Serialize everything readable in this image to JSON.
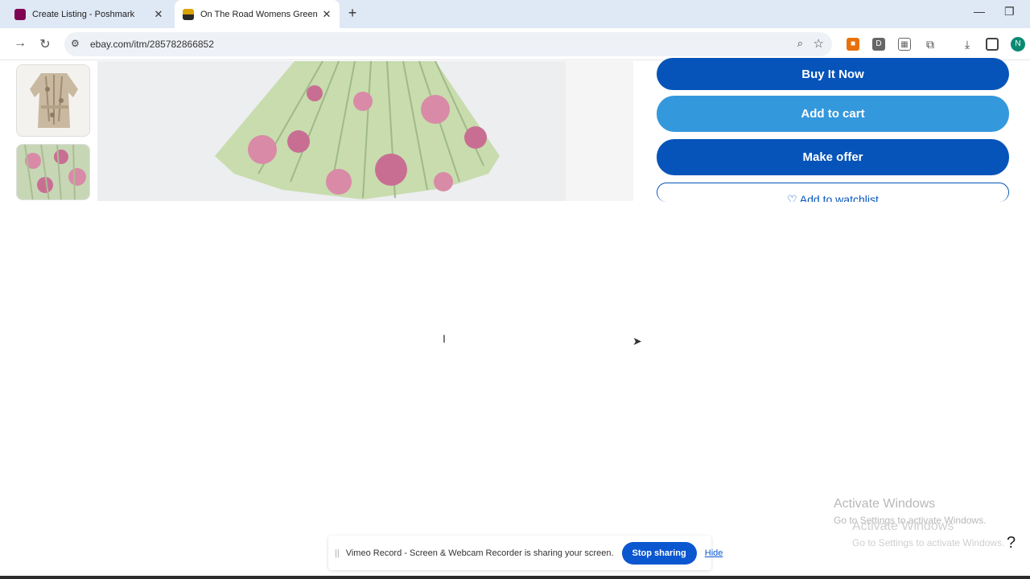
{
  "browser": {
    "tabs": [
      {
        "title": "Create Listing - Poshmark",
        "favicon_color": "#7f0353"
      },
      {
        "title": "On The Road Womens Green F",
        "favicon_color": "#d9a300"
      }
    ],
    "url": "ebay.com/itm/285782866852",
    "profile_initial": "N"
  },
  "listing": {
    "buttons": {
      "buy_it_now": "Buy It Now",
      "add_to_cart": "Add to cart",
      "make_offer": "Make offer",
      "add_to_watchlist": "♡ Add to watchlist"
    }
  },
  "overlay": {
    "activate_title": "Activate Windows",
    "activate_sub": "Go to Settings to activate Windows.",
    "share_message": "Vimeo Record - Screen & Webcam Recorder is sharing your screen.",
    "stop_sharing": "Stop sharing",
    "hide": "Hide"
  },
  "colors": {
    "ebay_blue": "#0654ba",
    "cart_blue": "#3498dd",
    "share_blue": "#0b57d0"
  }
}
